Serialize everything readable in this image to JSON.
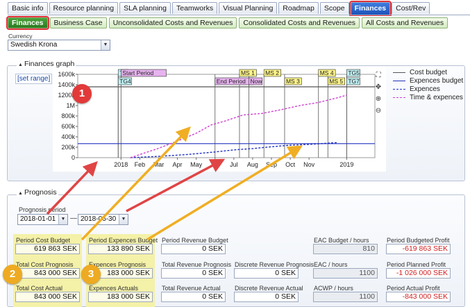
{
  "tabs_top": [
    {
      "label": "Basic info"
    },
    {
      "label": "Resource planning"
    },
    {
      "label": "SLA planning"
    },
    {
      "label": "Teamworks"
    },
    {
      "label": "Visual Planning"
    },
    {
      "label": "Roadmap"
    },
    {
      "label": "Scope"
    },
    {
      "label": "Finances",
      "active": true
    },
    {
      "label": "Cost/Rev"
    }
  ],
  "tabs_sub": [
    {
      "label": "Finances",
      "active": true
    },
    {
      "label": "Business Case"
    },
    {
      "label": "Unconsolidated Costs and Revenues"
    },
    {
      "label": "Consolidated Costs and Revenues"
    },
    {
      "label": "All Costs and Revenues"
    }
  ],
  "currency": {
    "label": "Currency",
    "value": "Swedish Krona"
  },
  "graph_panel": {
    "title": "Finances graph",
    "set_range": "[set range]",
    "legend": [
      {
        "label": "Cost budget",
        "color": "#555555",
        "dashed": false
      },
      {
        "label": "Expences budget",
        "color": "#2030c0",
        "dashed": false
      },
      {
        "label": "Expences",
        "color": "#2030c0",
        "dashed": true
      },
      {
        "label": "Time & expences",
        "color": "#d040d0",
        "dashed": true
      }
    ]
  },
  "chart_data": {
    "type": "line",
    "y_ticks": [
      "1600k",
      "1400k",
      "1200k",
      "1M",
      "800k",
      "600k",
      "400k",
      "200k",
      "0"
    ],
    "y_tick_values": [
      1600000,
      1400000,
      1200000,
      1000000,
      800000,
      600000,
      400000,
      200000,
      0
    ],
    "ylim": [
      0,
      1600000
    ],
    "x_ticks": [
      "2018",
      "Feb",
      "Mar",
      "Apr",
      "May",
      "Jun",
      "Jul",
      "Aug",
      "Sep",
      "Oct",
      "Nov",
      "2019"
    ],
    "x_tick_months": [
      0,
      1,
      2,
      3,
      4,
      5,
      6,
      7,
      8,
      9,
      10,
      12
    ],
    "xlim_months": [
      -2.3,
      13.5
    ],
    "series": [
      {
        "name": "Cost budget",
        "color": "#555555",
        "dashed": false,
        "points": [
          [
            -2.3,
            1360000
          ],
          [
            13.5,
            1360000
          ]
        ]
      },
      {
        "name": "Expences budget",
        "color": "#2030c0",
        "dashed": false,
        "points": [
          [
            -2.3,
            270000
          ],
          [
            13.5,
            270000
          ]
        ]
      },
      {
        "name": "Expences",
        "color": "#2030c0",
        "dashed": true,
        "points": [
          [
            0.5,
            0
          ],
          [
            2.0,
            25000
          ],
          [
            3.5,
            60000
          ],
          [
            5.0,
            110000
          ],
          [
            6.0,
            150000
          ],
          [
            7.0,
            175000
          ],
          [
            8.0,
            210000
          ],
          [
            9.0,
            240000
          ],
          [
            10.0,
            255000
          ],
          [
            11.5,
            290000
          ]
        ]
      },
      {
        "name": "Time & expences",
        "color": "#d040d0",
        "dashed": true,
        "points": [
          [
            0.5,
            0
          ],
          [
            1.0,
            60000
          ],
          [
            2.0,
            180000
          ],
          [
            3.0,
            320000
          ],
          [
            4.0,
            470000
          ],
          [
            4.8,
            630000
          ],
          [
            5.5,
            700000
          ],
          [
            6.5,
            820000
          ],
          [
            7.5,
            850000
          ],
          [
            8.5,
            920000
          ],
          [
            9.5,
            1000000
          ],
          [
            10.5,
            1060000
          ],
          [
            11.5,
            1150000
          ],
          [
            12.0,
            1200000
          ]
        ]
      }
    ],
    "milestones": [
      {
        "label": "TG",
        "month": -0.15,
        "row": 0,
        "color": "#bfeff2"
      },
      {
        "label": "TG4",
        "month": -0.15,
        "row": 1,
        "color": "#bfeff2"
      },
      {
        "label": "Start Period",
        "month": 0.0,
        "row": 0,
        "color": "#e6b3ee"
      },
      {
        "label": "End Period",
        "month": 5.0,
        "row": 1,
        "color": "#e6b3ee"
      },
      {
        "label": "MS 1",
        "month": 6.3,
        "row": 0,
        "color": "#fbf38a"
      },
      {
        "label": "Now",
        "month": 6.8,
        "row": 1,
        "color": "#e6b3ee"
      },
      {
        "label": "MS 2",
        "month": 7.6,
        "row": 0,
        "color": "#fbf38a"
      },
      {
        "label": "MS 3",
        "month": 8.7,
        "row": 1,
        "color": "#fbf38a"
      },
      {
        "label": "MS 4",
        "month": 10.5,
        "row": 0,
        "color": "#fbf38a"
      },
      {
        "label": "MS 5",
        "month": 11.0,
        "row": 1,
        "color": "#fbf38a"
      },
      {
        "label": "TG5",
        "month": 12.0,
        "row": 0,
        "color": "#bfeff2"
      },
      {
        "label": "TG7",
        "month": 12.0,
        "row": 1,
        "color": "#bfeff2"
      }
    ]
  },
  "prognosis": {
    "title": "Prognosis",
    "period_label": "Prognosis period",
    "period_from": "2018-01-01",
    "period_sep": "—",
    "period_to": "2018-06-30",
    "fields": [
      {
        "label": "Period Cost Budget",
        "value": "619 863 SEK"
      },
      {
        "label": "Period Expences Budget",
        "value": "133 890 SEK"
      },
      {
        "label": "Period Revenue Budget",
        "value": "0 SEK"
      },
      {
        "label": "EAC Budget / hours",
        "value": "810"
      },
      {
        "label": "Period Budgeted Profit",
        "value": "-619 863 SEK"
      },
      {
        "label": "Total Cost Prognosis",
        "value": "843 000 SEK"
      },
      {
        "label": "Expences Prognosis",
        "value": "183 000 SEK"
      },
      {
        "label": "Total Revenue Prognosis",
        "value": "0 SEK"
      },
      {
        "label": "Discrete Revenue Prognosis",
        "value": "0 SEK"
      },
      {
        "label": "EAC / hours",
        "value": "1100"
      },
      {
        "label": "Period Planned Profit",
        "value": "-1 026 000 SEK"
      },
      {
        "label": "Total Cost Actual",
        "value": "843 000 SEK"
      },
      {
        "label": "Expences Actuals",
        "value": "183 000 SEK"
      },
      {
        "label": "Total Revenue Actual",
        "value": "0 SEK"
      },
      {
        "label": "Discrete Revenue Actual",
        "value": "0 SEK"
      },
      {
        "label": "ACWP / hours",
        "value": "1100"
      },
      {
        "label": "Period Actual Profit",
        "value": "-843 000 SEK"
      }
    ]
  },
  "badges": [
    {
      "label": "1",
      "color": "#e23a3a"
    },
    {
      "label": "2",
      "color": "#eeaa22"
    },
    {
      "label": "3",
      "color": "#eeaa22"
    }
  ]
}
